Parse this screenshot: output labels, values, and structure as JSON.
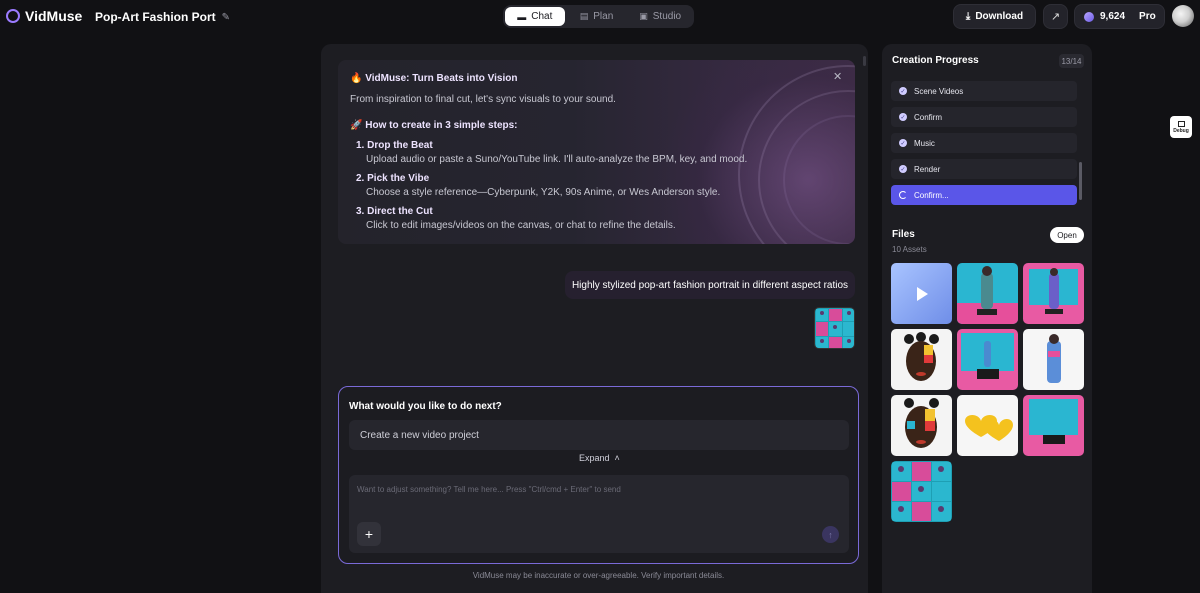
{
  "app": {
    "name": "VidMuse",
    "project_title": "Pop-Art Fashion Port"
  },
  "modes": [
    {
      "label": "Chat",
      "icon": "chat-icon",
      "active": true
    },
    {
      "label": "Plan",
      "icon": "plan-icon",
      "active": false
    },
    {
      "label": "Studio",
      "icon": "studio-icon",
      "active": false
    }
  ],
  "topbar": {
    "download_label": "Download",
    "credits": "9,624",
    "plan": "Pro"
  },
  "intro": {
    "emoji": "🔥",
    "title": "VidMuse: Turn Beats into Vision",
    "subtitle": "From inspiration to final cut, let's sync visuals to your sound.",
    "how_emoji": "🚀",
    "how_title": "How to create in 3 simple steps:",
    "steps": [
      {
        "heading": "1. Drop the Beat",
        "desc": "Upload audio or paste a Suno/YouTube link. I'll auto-analyze the BPM, key, and mood."
      },
      {
        "heading": "2. Pick the Vibe",
        "desc": "Choose a style reference—Cyberpunk, Y2K, 90s Anime, or Wes Anderson style."
      },
      {
        "heading": "3. Direct the Cut",
        "desc": "Click to edit images/videos on the canvas, or chat to refine the details."
      }
    ]
  },
  "user_message": "Highly stylized pop-art fashion portrait in different aspect ratios",
  "composer": {
    "question": "What would you like to do next?",
    "suggestion": "Create a new video project",
    "expand_label": "Expand",
    "placeholder": "Want to adjust something? Tell me here... Press \"Ctrl/cmd + Enter\" to send"
  },
  "disclaimer": "VidMuse may be inaccurate or over-agreeable. Verify important details.",
  "progress": {
    "title": "Creation Progress",
    "count": "13/14",
    "items": [
      {
        "label": "Scene Videos",
        "state": "done"
      },
      {
        "label": "Confirm",
        "state": "done"
      },
      {
        "label": "Music",
        "state": "done"
      },
      {
        "label": "Render",
        "state": "done"
      },
      {
        "label": "Confirm...",
        "state": "active"
      }
    ]
  },
  "files": {
    "title": "Files",
    "count": "10 Assets",
    "open_label": "Open"
  },
  "debug_label": "Debug",
  "colors": {
    "accent": "#5a56e8",
    "composer_border": "#7a6ad8",
    "brand": "#9b7bff"
  }
}
